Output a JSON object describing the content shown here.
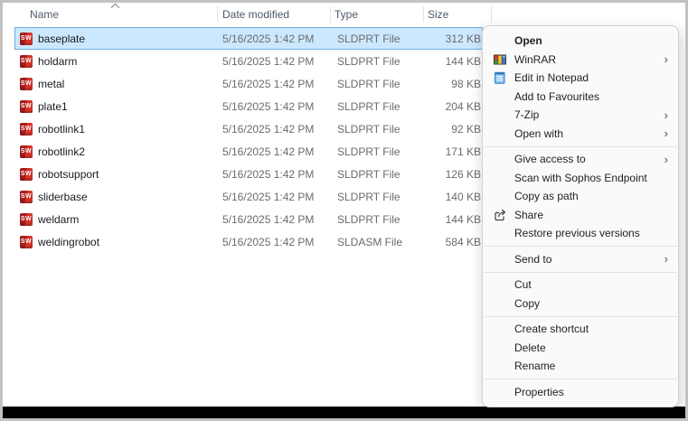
{
  "window": {
    "columns": [
      {
        "label": "Name"
      },
      {
        "label": "Date modified"
      },
      {
        "label": "Type"
      },
      {
        "label": "Size"
      }
    ],
    "sort": {
      "column": "Name",
      "direction": "ascending"
    },
    "files": [
      {
        "name": "baseplate",
        "date": "5/16/2025 1:42 PM",
        "type": "SLDPRT File",
        "size": "312 KB",
        "selected": true
      },
      {
        "name": "holdarm",
        "date": "5/16/2025 1:42 PM",
        "type": "SLDPRT File",
        "size": "144 KB",
        "selected": false
      },
      {
        "name": "metal",
        "date": "5/16/2025 1:42 PM",
        "type": "SLDPRT File",
        "size": "98 KB",
        "selected": false
      },
      {
        "name": "plate1",
        "date": "5/16/2025 1:42 PM",
        "type": "SLDPRT File",
        "size": "204 KB",
        "selected": false
      },
      {
        "name": "robotlink1",
        "date": "5/16/2025 1:42 PM",
        "type": "SLDPRT File",
        "size": "92 KB",
        "selected": false
      },
      {
        "name": "robotlink2",
        "date": "5/16/2025 1:42 PM",
        "type": "SLDPRT File",
        "size": "171 KB",
        "selected": false
      },
      {
        "name": "robotsupport",
        "date": "5/16/2025 1:42 PM",
        "type": "SLDPRT File",
        "size": "126 KB",
        "selected": false
      },
      {
        "name": "sliderbase",
        "date": "5/16/2025 1:42 PM",
        "type": "SLDPRT File",
        "size": "140 KB",
        "selected": false
      },
      {
        "name": "weldarm",
        "date": "5/16/2025 1:42 PM",
        "type": "SLDPRT File",
        "size": "144 KB",
        "selected": false
      },
      {
        "name": "weldingrobot",
        "date": "5/16/2025 1:42 PM",
        "type": "SLDASM File",
        "size": "584 KB",
        "selected": false
      }
    ]
  },
  "context_menu": {
    "sections": [
      {
        "items": [
          {
            "label": "Open",
            "bold": true
          },
          {
            "label": "WinRAR",
            "icon": "winrar",
            "submenu": true
          },
          {
            "label": "Edit in Notepad",
            "icon": "notepad"
          },
          {
            "label": "Add to Favourites"
          },
          {
            "label": "7-Zip",
            "submenu": true
          },
          {
            "label": "Open with",
            "submenu": true
          }
        ]
      },
      {
        "items": [
          {
            "label": "Give access to",
            "submenu": true
          },
          {
            "label": "Scan with Sophos Endpoint"
          },
          {
            "label": "Copy as path"
          },
          {
            "label": "Share",
            "icon": "share"
          },
          {
            "label": "Restore previous versions"
          }
        ]
      },
      {
        "items": [
          {
            "label": "Send to",
            "submenu": true
          }
        ]
      },
      {
        "items": [
          {
            "label": "Cut"
          },
          {
            "label": "Copy"
          }
        ]
      },
      {
        "items": [
          {
            "label": "Create shortcut"
          },
          {
            "label": "Delete"
          },
          {
            "label": "Rename"
          }
        ]
      },
      {
        "items": [
          {
            "label": "Properties"
          }
        ]
      }
    ]
  },
  "icons": {
    "solidworks_glyph": "SW"
  },
  "colors": {
    "selection_fill": "#cce8ff",
    "selection_border": "#70aede",
    "menu_background": "#fafafa",
    "file_icon_red": "#d8352a",
    "black_bar": "#000000"
  }
}
